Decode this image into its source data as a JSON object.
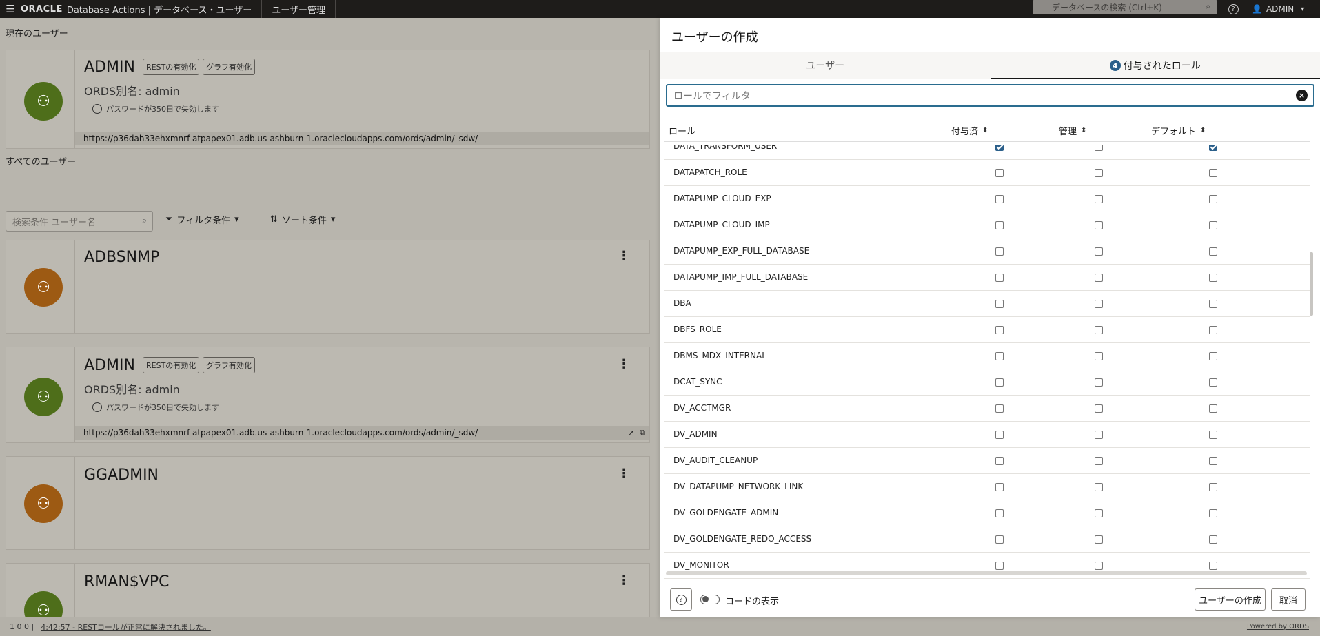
{
  "topbar": {
    "brand_oracle": "ORACLE",
    "brand_app": "Database Actions | データベース・ユーザー",
    "page_tab": "ユーザー管理",
    "search_placeholder": "データベースの検索 (Ctrl+K)",
    "user": "ADMIN"
  },
  "left": {
    "current_user_title": "現在のユーザー",
    "all_users_title": "すべてのユーザー",
    "search_placeholder": "検索条件 ユーザー名",
    "filter_label": "フィルタ条件",
    "sort_label": "ソート条件",
    "current_user": {
      "name": "ADMIN",
      "badge_rest": "RESTの有効化",
      "badge_graph": "グラフ有効化",
      "alias": "ORDS別名: admin",
      "password_note": "パスワードが350日で失効します",
      "url": "https://p36dah33ehxmnrf-atpapex01.adb.us-ashburn-1.oraclecloudapps.com/ords/admin/_sdw/"
    },
    "users": [
      {
        "name": "ADBSNMP"
      },
      {
        "name": "ADMIN",
        "badge_rest": "RESTの有効化",
        "badge_graph": "グラフ有効化",
        "alias": "ORDS別名: admin",
        "password_note": "パスワードが350日で失効します",
        "url": "https://p36dah33ehxmnrf-atpapex01.adb.us-ashburn-1.oraclecloudapps.com/ords/admin/_sdw/"
      },
      {
        "name": "GGADMIN"
      },
      {
        "name": "RMAN$VPC"
      }
    ]
  },
  "status": {
    "counts": "1   0   0  |",
    "message": "4:42:57 - RESTコールが正常に解決されました。",
    "powered": "Powered by ORDS"
  },
  "drawer": {
    "title": "ユーザーの作成",
    "tab_user": "ユーザー",
    "tab_roles_count": "4",
    "tab_roles": "付与されたロール",
    "filter_placeholder": "ロールでフィルタ",
    "col_role": "ロール",
    "col_granted": "付与済",
    "col_admin": "管理",
    "col_default": "デフォルト",
    "roles": [
      {
        "name": "DATA_TRANSFORM_USER",
        "granted": true,
        "admin": false,
        "default": true
      },
      {
        "name": "DATAPATCH_ROLE",
        "granted": false,
        "admin": false,
        "default": false
      },
      {
        "name": "DATAPUMP_CLOUD_EXP",
        "granted": false,
        "admin": false,
        "default": false
      },
      {
        "name": "DATAPUMP_CLOUD_IMP",
        "granted": false,
        "admin": false,
        "default": false
      },
      {
        "name": "DATAPUMP_EXP_FULL_DATABASE",
        "granted": false,
        "admin": false,
        "default": false
      },
      {
        "name": "DATAPUMP_IMP_FULL_DATABASE",
        "granted": false,
        "admin": false,
        "default": false
      },
      {
        "name": "DBA",
        "granted": false,
        "admin": false,
        "default": false
      },
      {
        "name": "DBFS_ROLE",
        "granted": false,
        "admin": false,
        "default": false
      },
      {
        "name": "DBMS_MDX_INTERNAL",
        "granted": false,
        "admin": false,
        "default": false
      },
      {
        "name": "DCAT_SYNC",
        "granted": false,
        "admin": false,
        "default": false
      },
      {
        "name": "DV_ACCTMGR",
        "granted": false,
        "admin": false,
        "default": false
      },
      {
        "name": "DV_ADMIN",
        "granted": false,
        "admin": false,
        "default": false
      },
      {
        "name": "DV_AUDIT_CLEANUP",
        "granted": false,
        "admin": false,
        "default": false
      },
      {
        "name": "DV_DATAPUMP_NETWORK_LINK",
        "granted": false,
        "admin": false,
        "default": false
      },
      {
        "name": "DV_GOLDENGATE_ADMIN",
        "granted": false,
        "admin": false,
        "default": false
      },
      {
        "name": "DV_GOLDENGATE_REDO_ACCESS",
        "granted": false,
        "admin": false,
        "default": false
      },
      {
        "name": "DV_MONITOR",
        "granted": false,
        "admin": false,
        "default": false
      }
    ],
    "show_code_label": "コードの表示",
    "create_button": "ユーザーの作成",
    "cancel_button": "取消"
  }
}
